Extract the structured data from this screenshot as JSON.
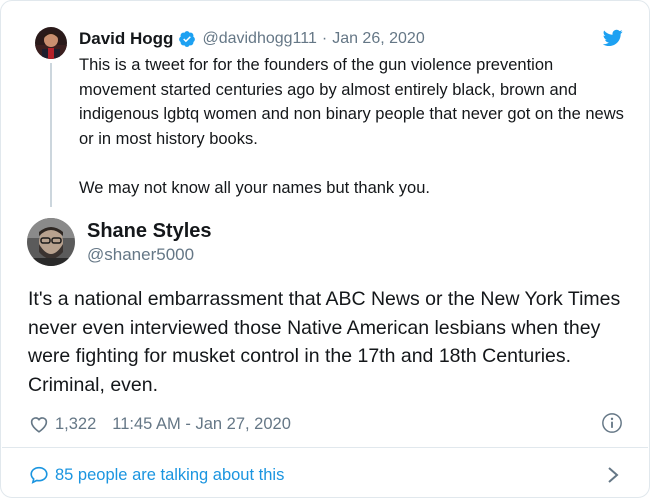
{
  "parent_tweet": {
    "author_name": "David Hogg",
    "handle": "@davidhogg111",
    "separator": "·",
    "date": "Jan 26, 2020",
    "paragraphs": [
      "This is a tweet for for the founders of the gun violence prevention movement started centuries ago by almost entirely black, brown and indigenous lgbtq women and non binary people that never got on the news or in most history books.",
      "We may not know all your names but thank you."
    ],
    "verified_icon": "verified-badge-icon",
    "brand_icon": "twitter-bird-icon"
  },
  "tweet": {
    "author_name": "Shane Styles",
    "handle": "@shaner5000",
    "text": "It's a national embarrassment that ABC News or the New York Times never even interviewed those Native American lesbians when they were fighting for musket control in the 17th and 18th Centuries. Criminal, even.",
    "like_count": "1,322",
    "timestamp": "11:45 AM - Jan 27, 2020"
  },
  "footer": {
    "talking_label": "85 people are talking about this"
  },
  "colors": {
    "accent": "#1da1f2",
    "link": "#1b95e0",
    "secondary_text": "#657786",
    "border": "#e1e8ed"
  }
}
